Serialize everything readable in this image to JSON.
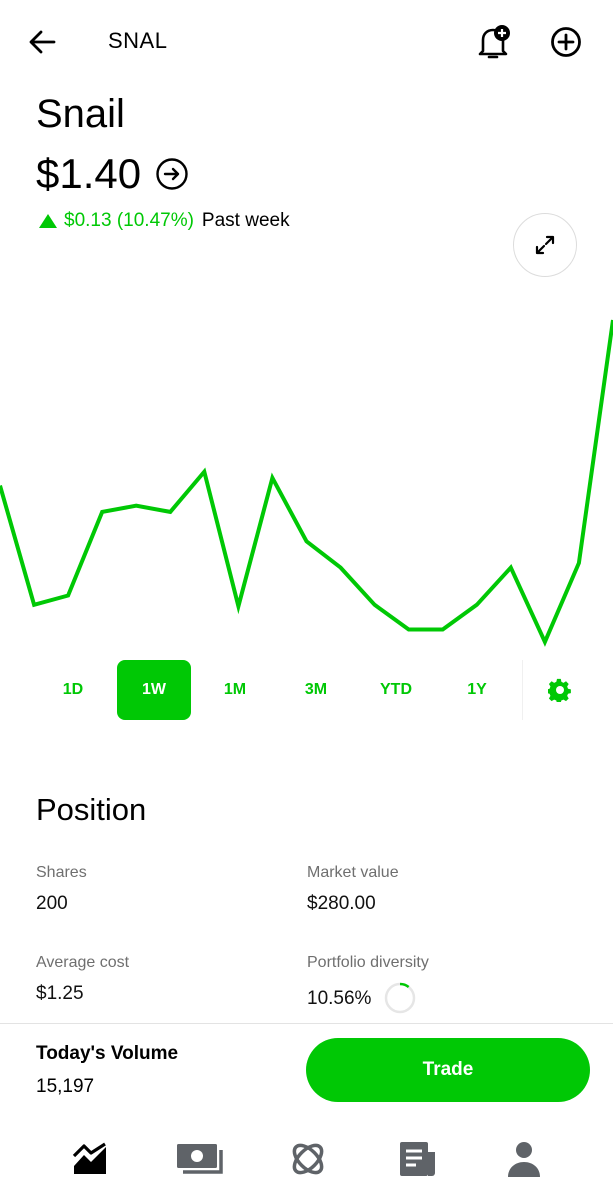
{
  "header": {
    "ticker": "SNAL",
    "icons": [
      "arrow-left-icon",
      "bell-plus-icon",
      "plus-circle-icon"
    ]
  },
  "stock": {
    "name": "Snail",
    "price": "$1.40",
    "change": "$0.13 (10.47%)",
    "period_label": "Past week"
  },
  "colors": {
    "accent": "#00c805",
    "line": "#00c805"
  },
  "chart_data": {
    "type": "line",
    "x": [
      0,
      1,
      2,
      3,
      4,
      5,
      6,
      7,
      8,
      9,
      10,
      11,
      12,
      13,
      14,
      15,
      16,
      17
    ],
    "series": [
      {
        "values": [
          1.293,
          1.216,
          1.222,
          1.276,
          1.28,
          1.276,
          1.302,
          1.215,
          1.298,
          1.257,
          1.24,
          1.216,
          1.2,
          1.2,
          1.216,
          1.24,
          1.192,
          1.243,
          1.4
        ]
      }
    ],
    "ylim": [
      1.19,
      1.4
    ]
  },
  "ranges": {
    "items": [
      "1D",
      "1W",
      "1M",
      "3M",
      "YTD",
      "1Y"
    ],
    "active": "1W"
  },
  "position": {
    "title": "Position",
    "shares_label": "Shares",
    "shares_value": "200",
    "market_value_label": "Market value",
    "market_value": "$280.00",
    "avg_cost_label": "Average cost",
    "avg_cost": "$1.25",
    "diversity_label": "Portfolio diversity",
    "diversity_value": "10.56%",
    "diversity_fraction": 0.1056
  },
  "footer": {
    "volume_label": "Today's Volume",
    "volume_value": "15,197",
    "trade_label": "Trade"
  },
  "bottom_nav": [
    "chart-icon",
    "cash-icon",
    "crypto-icon",
    "news-icon",
    "account-icon"
  ]
}
